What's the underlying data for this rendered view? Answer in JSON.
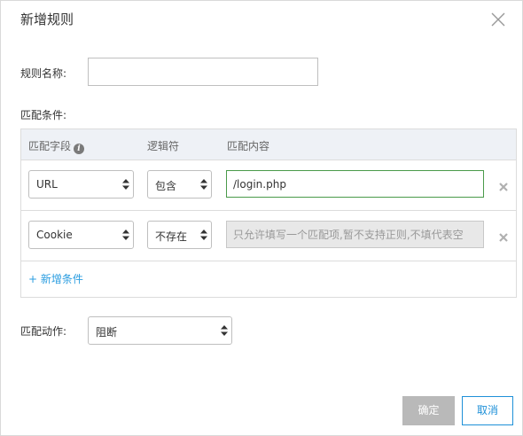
{
  "dialog": {
    "title": "新增规则",
    "close_icon": "close-icon"
  },
  "form": {
    "rule_name_label": "规则名称:",
    "rule_name_value": "",
    "conditions_label": "匹配条件:",
    "action_label": "匹配动作:",
    "action_value": "阻断"
  },
  "table": {
    "headers": {
      "field": "匹配字段",
      "operator": "逻辑符",
      "content": "匹配内容"
    },
    "info_icon": "info-icon",
    "rows": [
      {
        "field": "URL",
        "operator": "包含",
        "content_value": "/login.php",
        "content_placeholder": ""
      },
      {
        "field": "Cookie",
        "operator": "不存在",
        "content_value": "",
        "content_placeholder": "只允许填写一个匹配项,暂不支持正则,不填代表空"
      }
    ],
    "add_condition": "+ 新增条件"
  },
  "buttons": {
    "ok": "确定",
    "cancel": "取消"
  },
  "colors": {
    "link_blue": "#2a9de0",
    "active_border_green": "#4a9a4a",
    "header_bg": "#eef1f6",
    "disabled_button": "#b9b9b9"
  }
}
